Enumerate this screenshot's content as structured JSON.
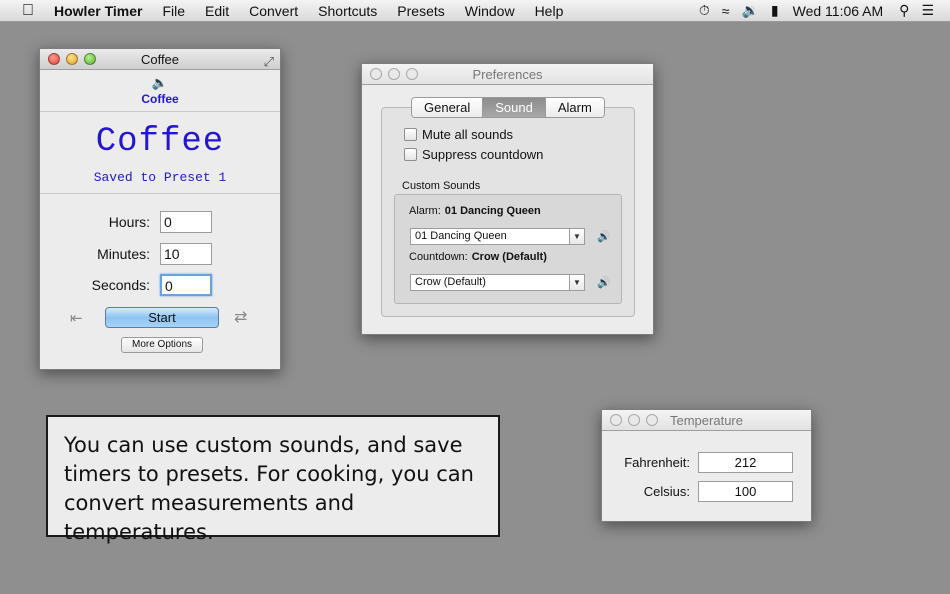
{
  "menubar": {
    "apple_glyph": "",
    "app_name": "Howler Timer",
    "items": [
      "File",
      "Edit",
      "Convert",
      "Shortcuts",
      "Presets",
      "Window",
      "Help"
    ],
    "clock": "Wed 11:06 AM",
    "status_icons": [
      "timer-icon",
      "wifi-icon",
      "volume-icon",
      "battery-icon",
      "spotlight-icon",
      "list-icon"
    ]
  },
  "coffee_window": {
    "title": "Coffee",
    "mini_name": "Coffee",
    "timer_name": "Coffee",
    "status": "Saved to Preset 1",
    "hours_label": "Hours:",
    "hours_value": "0",
    "minutes_label": "Minutes:",
    "minutes_value": "10",
    "seconds_label": "Seconds:",
    "seconds_value": "0",
    "start_label": "Start",
    "more_options_label": "More Options",
    "name_color": "#2416d0"
  },
  "prefs_window": {
    "title": "Preferences",
    "tabs": [
      "General",
      "Sound",
      "Alarm"
    ],
    "selected_tab": "Sound",
    "mute_label": "Mute all sounds",
    "suppress_label": "Suppress countdown",
    "custom_sounds_label": "Custom Sounds",
    "alarm_label": "Alarm:",
    "alarm_value": "01 Dancing Queen",
    "alarm_popup": "01 Dancing Queen",
    "countdown_label": "Countdown:",
    "countdown_value": "Crow (Default)",
    "countdown_popup": "Crow (Default)"
  },
  "caption": {
    "text": "You can use custom sounds, and save timers to presets. For cooking, you can convert measurements and temperatures."
  },
  "temp_window": {
    "title": "Temperature",
    "fahrenheit_label": "Fahrenheit:",
    "fahrenheit_value": "212",
    "celsius_label": "Celsius:",
    "celsius_value": "100"
  }
}
